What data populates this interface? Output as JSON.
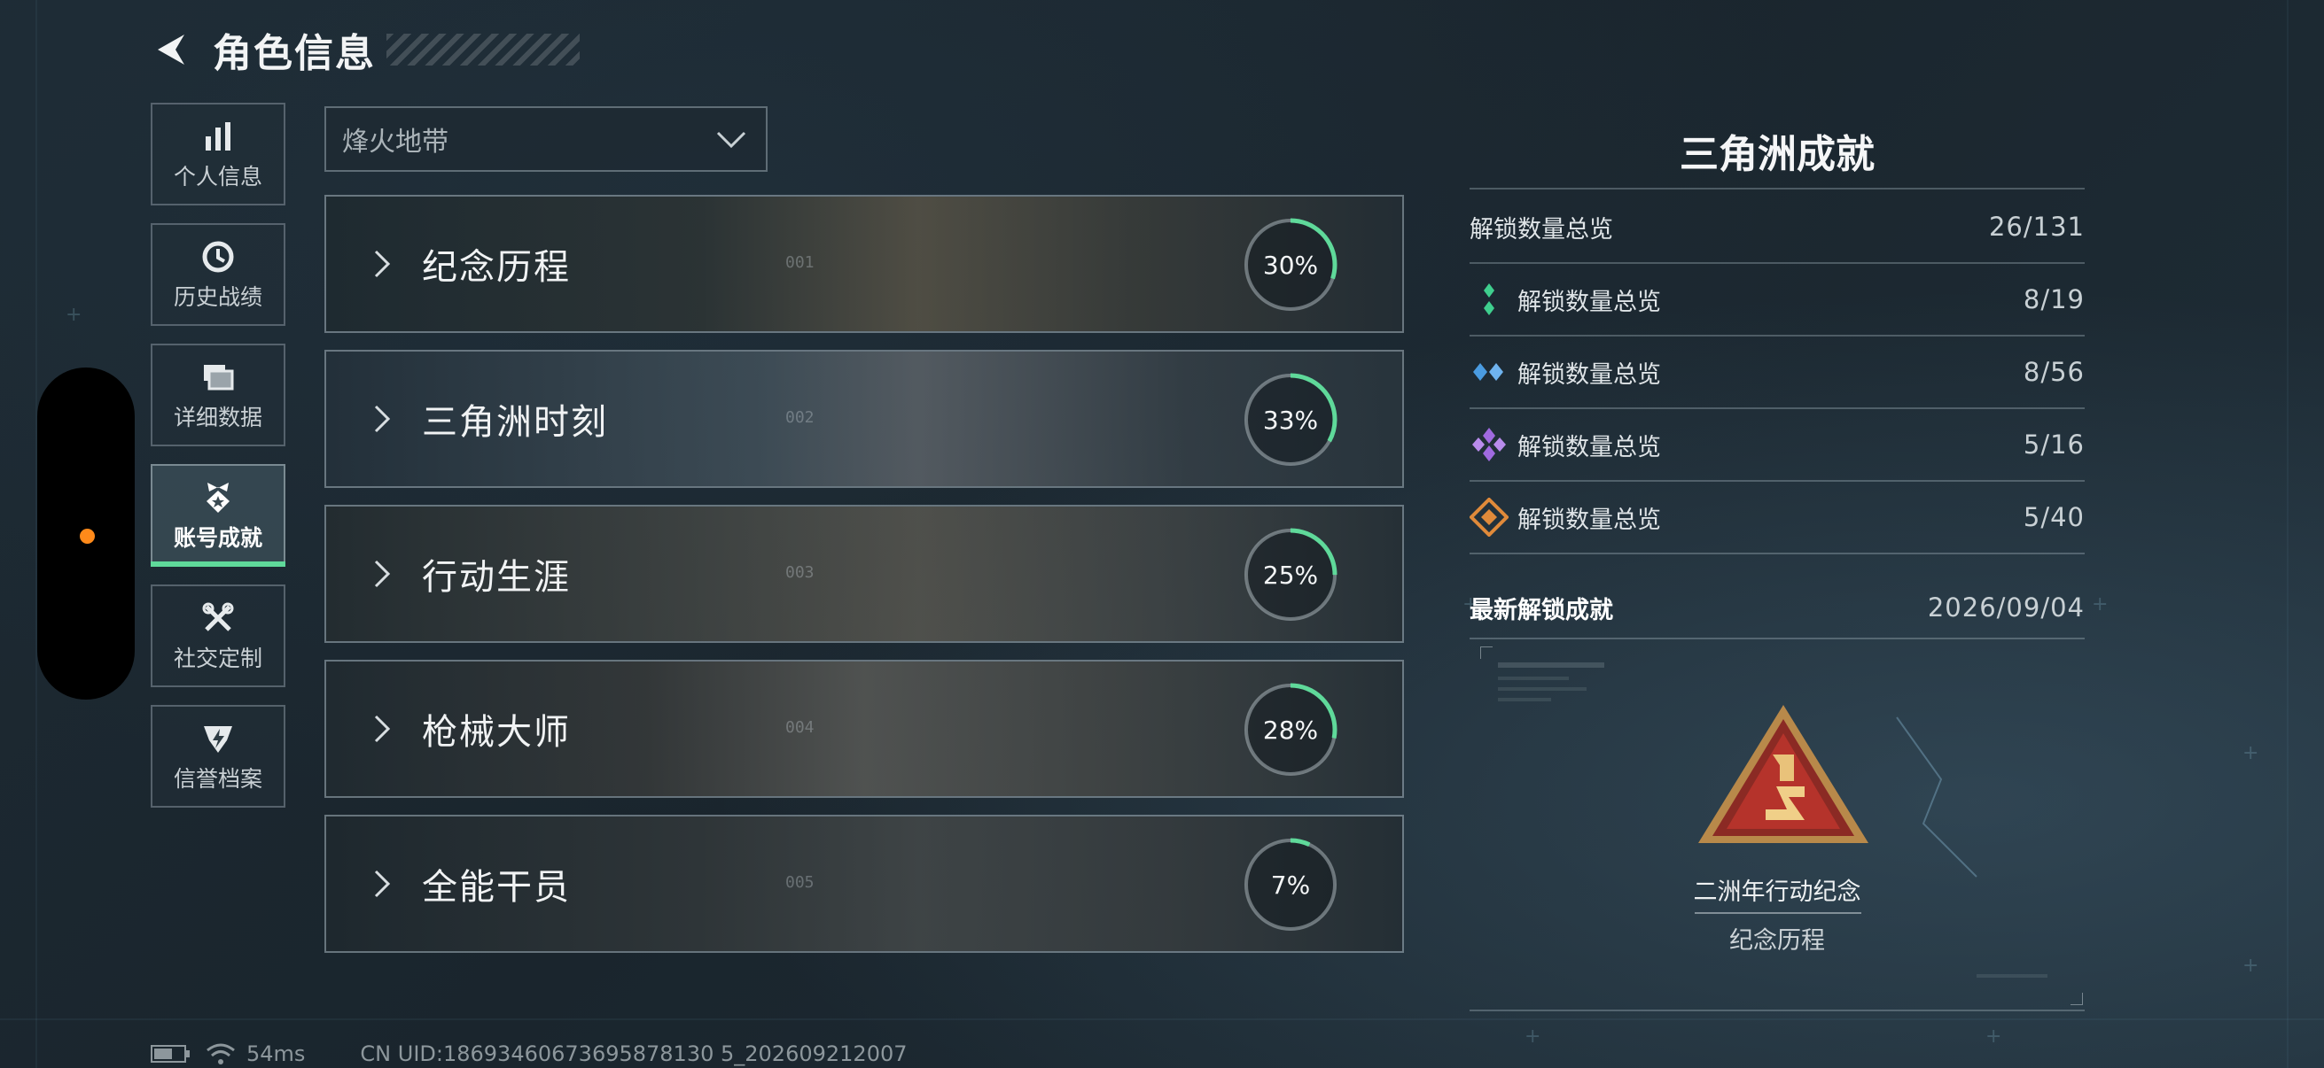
{
  "header": {
    "title": "角色信息"
  },
  "sidebar": {
    "items": [
      {
        "label": "个人信息",
        "icon": "bar-chart-icon"
      },
      {
        "label": "历史战绩",
        "icon": "history-clock-icon"
      },
      {
        "label": "详细数据",
        "icon": "folders-icon"
      },
      {
        "label": "账号成就",
        "icon": "achievement-badge-icon",
        "active": true
      },
      {
        "label": "社交定制",
        "icon": "tools-icon"
      },
      {
        "label": "信誉档案",
        "icon": "shield-lightning-icon"
      }
    ]
  },
  "mode_select": {
    "value": "烽火地带"
  },
  "categories": [
    {
      "name": "纪念历程",
      "progress_label": "30%",
      "progress": 0.3,
      "index_label": "001"
    },
    {
      "name": "三角洲时刻",
      "progress_label": "33%",
      "progress": 0.33,
      "index_label": "002"
    },
    {
      "name": "行动生涯",
      "progress_label": "25%",
      "progress": 0.25,
      "index_label": "003"
    },
    {
      "name": "枪械大师",
      "progress_label": "28%",
      "progress": 0.28,
      "index_label": "004"
    },
    {
      "name": "全能干员",
      "progress_label": "7%",
      "progress": 0.07,
      "index_label": "005"
    }
  ],
  "achievements": {
    "title": "三角洲成就",
    "total": {
      "label": "解锁数量总览",
      "value": "26/131"
    },
    "tiers": [
      {
        "label": "解锁数量总览",
        "value": "8/19",
        "icon": "green-diamond-icon",
        "color": "#3fcf8e"
      },
      {
        "label": "解锁数量总览",
        "value": "8/56",
        "icon": "blue-diamond-icon",
        "color": "#4a9be0"
      },
      {
        "label": "解锁数量总览",
        "value": "5/16",
        "icon": "purple-diamond-icon",
        "color": "#a06ae0"
      },
      {
        "label": "解锁数量总览",
        "value": "5/40",
        "icon": "orange-diamond-icon",
        "color": "#e08a3a"
      }
    ],
    "latest": {
      "label": "最新解锁成就",
      "date": "2026/09/04"
    },
    "badge": {
      "name": "二洲年行动纪念",
      "category": "纪念历程"
    }
  },
  "footer": {
    "ping": "54ms",
    "uid": "CN UID:18693460673695878130 5_202609212007"
  },
  "colors": {
    "accent_green": "#5fd99a",
    "handle_dot": "#ff8a1a"
  }
}
